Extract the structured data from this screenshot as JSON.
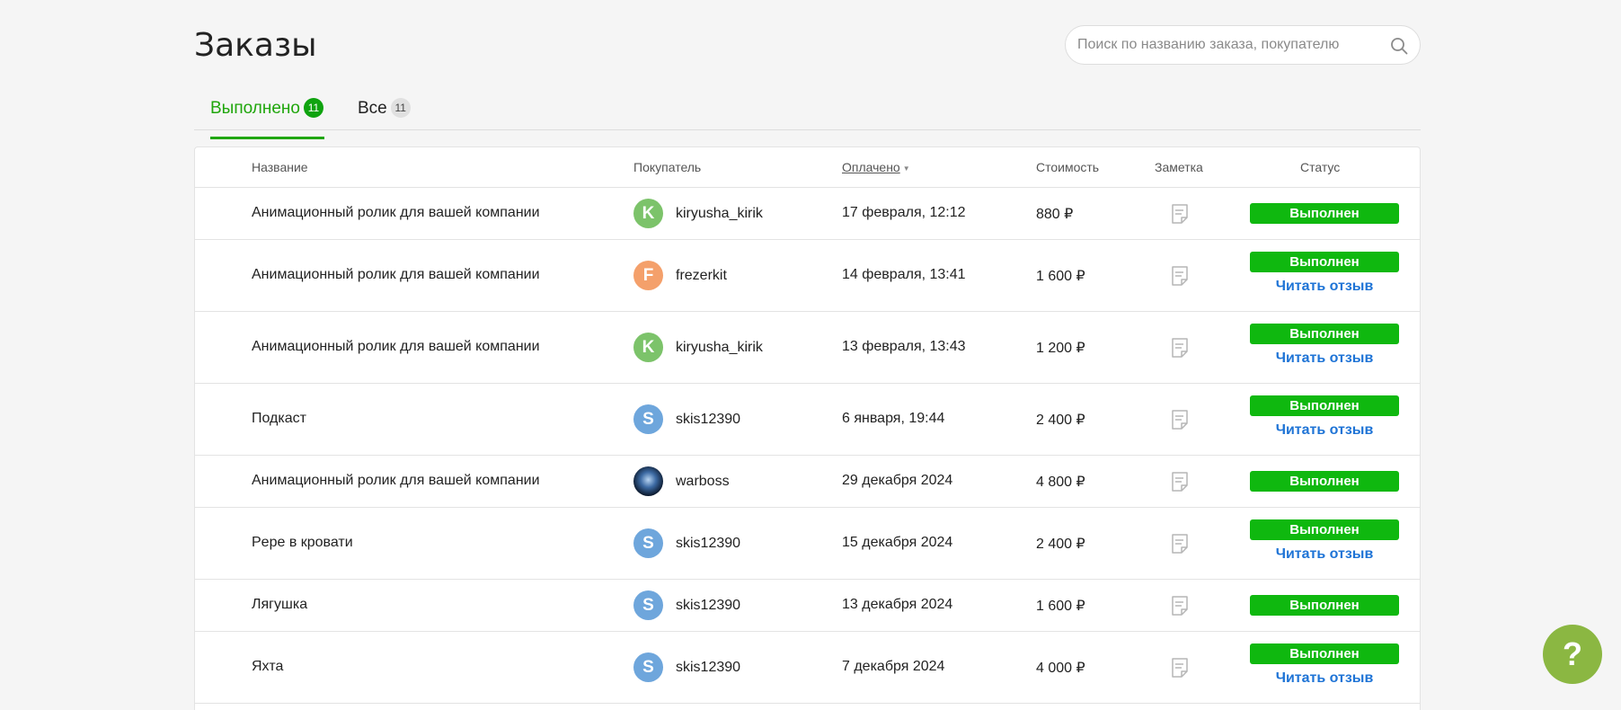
{
  "page": {
    "title": "Заказы"
  },
  "search": {
    "placeholder": "Поиск по названию заказа, покупателю"
  },
  "tabs": [
    {
      "label": "Выполнено",
      "count": "11",
      "active": true
    },
    {
      "label": "Все",
      "count": "11",
      "active": false
    }
  ],
  "table": {
    "headers": {
      "name": "Название",
      "buyer": "Покупатель",
      "paid": "Оплачено",
      "price": "Стоимость",
      "note": "Заметка",
      "status": "Статус"
    },
    "rows": [
      {
        "name": "Анимационный ролик для вашей компании",
        "buyer": "kiryusha_kirik",
        "initial": "K",
        "avatar_color": "#7cc36a",
        "date": "17 февраля, 12:12",
        "price": "880 ₽",
        "status": "Выполнен",
        "review": ""
      },
      {
        "name": "Анимационный ролик для вашей компании",
        "buyer": "frezerkit",
        "initial": "F",
        "avatar_color": "#f4a06b",
        "date": "14 февраля, 13:41",
        "price": "1 600 ₽",
        "status": "Выполнен",
        "review": "Читать отзыв"
      },
      {
        "name": "Анимационный ролик для вашей компании",
        "buyer": "kiryusha_kirik",
        "initial": "K",
        "avatar_color": "#7cc36a",
        "date": "13 февраля, 13:43",
        "price": "1 200 ₽",
        "status": "Выполнен",
        "review": "Читать отзыв"
      },
      {
        "name": "Подкаст",
        "buyer": "skis12390",
        "initial": "S",
        "avatar_color": "#6ea6dc",
        "date": "6 января, 19:44",
        "price": "2 400 ₽",
        "status": "Выполнен",
        "review": "Читать отзыв"
      },
      {
        "name": "Анимационный ролик для вашей компании",
        "buyer": "warboss",
        "initial": "",
        "avatar_color": "",
        "avatar_image": true,
        "date": "29 декабря 2024",
        "price": "4 800 ₽",
        "status": "Выполнен",
        "review": ""
      },
      {
        "name": "Pepe в кровати",
        "buyer": "skis12390",
        "initial": "S",
        "avatar_color": "#6ea6dc",
        "date": "15 декабря 2024",
        "price": "2 400 ₽",
        "status": "Выполнен",
        "review": "Читать отзыв"
      },
      {
        "name": "Лягушка",
        "buyer": "skis12390",
        "initial": "S",
        "avatar_color": "#6ea6dc",
        "date": "13 декабря 2024",
        "price": "1 600 ₽",
        "status": "Выполнен",
        "review": ""
      },
      {
        "name": "Яхта",
        "buyer": "skis12390",
        "initial": "S",
        "avatar_color": "#6ea6dc",
        "date": "7 декабря 2024",
        "price": "4 000 ₽",
        "status": "Выполнен",
        "review": "Читать отзыв"
      }
    ]
  },
  "help": {
    "label": "?"
  }
}
